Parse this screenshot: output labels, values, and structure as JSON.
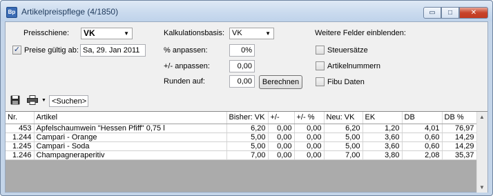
{
  "window": {
    "title": "Artikelpreispflege (4/1850)",
    "icon_text": "Bp",
    "minimize_glyph": "▭",
    "maximize_glyph": "□",
    "close_glyph": "✕"
  },
  "form": {
    "preisschiene_label": "Preisschiene:",
    "preisschiene_value": "VK",
    "preise_gueltig_label": "Preise gültig ab:",
    "preise_gueltig_checked": true,
    "preise_gueltig_value": "Sa, 29. Jan 2011",
    "kalkulationsbasis_label": "Kalkulationsbasis:",
    "kalkulationsbasis_value": "VK",
    "prozent_label": "% anpassen:",
    "prozent_value": "0%",
    "plusminus_label": "+/- anpassen:",
    "plusminus_value": "0,00",
    "runden_label": "Runden auf:",
    "runden_value": "0,00",
    "berechnen_label": "Berechnen",
    "weitere_label": "Weitere Felder einblenden:",
    "options": [
      {
        "label": "Steuersätze",
        "checked": false
      },
      {
        "label": "Artikelnummern",
        "checked": false
      },
      {
        "label": "Fibu Daten",
        "checked": false
      }
    ]
  },
  "toolbar": {
    "save_icon": "save-icon",
    "print_icon": "printer-icon",
    "search_value": "<Suchen>"
  },
  "table": {
    "columns": [
      "Nr.",
      "Artikel",
      "Bisher: VK",
      "+/-",
      "+/- %",
      "Neu: VK",
      "EK",
      "DB",
      "DB %"
    ],
    "rows": [
      [
        "453",
        "Apfelschaumwein \"Hessen Pfiff\" 0,75 l",
        "6,20",
        "0,00",
        "0,00",
        "6,20",
        "1,20",
        "4,01",
        "76,97"
      ],
      [
        "1.244",
        "Campari - Orange",
        "5,00",
        "0,00",
        "0,00",
        "5,00",
        "3,60",
        "0,60",
        "14,29"
      ],
      [
        "1.245",
        "Campari - Soda",
        "5,00",
        "0,00",
        "0,00",
        "5,00",
        "3,60",
        "0,60",
        "14,29"
      ],
      [
        "1.246",
        "Champagneraperitiv",
        "7,00",
        "0,00",
        "0,00",
        "7,00",
        "3,80",
        "2,08",
        "35,37"
      ]
    ]
  }
}
